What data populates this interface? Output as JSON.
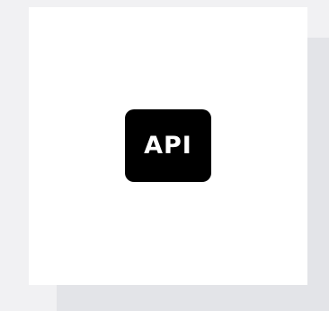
{
  "icon": {
    "name": "api-icon",
    "label": "API",
    "background_color": "#000000",
    "text_color": "#ffffff"
  },
  "colors": {
    "page_background": "#f1f1f3",
    "card_background": "#ffffff",
    "shadow_background": "#e3e4e8"
  }
}
